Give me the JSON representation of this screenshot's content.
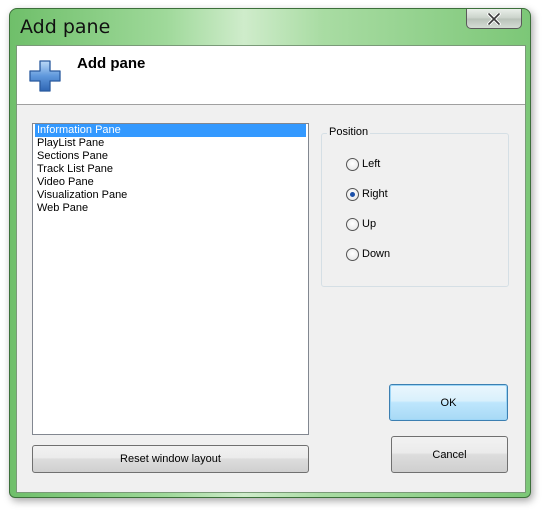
{
  "window": {
    "title": "Add pane"
  },
  "header": {
    "title": "Add pane",
    "icon": "plus-icon"
  },
  "list": {
    "items": [
      "Information Pane",
      "PlayList Pane",
      "Sections Pane",
      "Track List Pane",
      "Video Pane",
      "Visualization Pane",
      "Web Pane"
    ],
    "selected_index": 0
  },
  "position": {
    "label": "Position",
    "options": [
      "Left",
      "Right",
      "Up",
      "Down"
    ],
    "selected": "Right"
  },
  "buttons": {
    "reset": "Reset window layout",
    "ok": "OK",
    "cancel": "Cancel"
  },
  "colors": {
    "titlebar_accent": "#7cc777",
    "selection": "#3399ff",
    "header_icon": "#3a78c9"
  }
}
